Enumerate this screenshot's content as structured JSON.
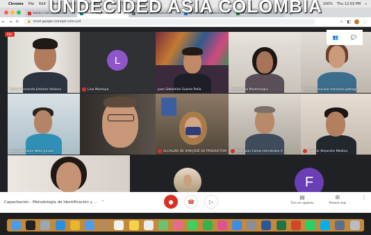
{
  "watermark": "UNDECIDED ASIA COLOMBIA",
  "menubar": {
    "app_name": "Chrome",
    "items": [
      "File",
      "Edit",
      "View",
      "History",
      "Bookmarks",
      "People",
      "Tab",
      "Window",
      "Help"
    ],
    "clock": "Thu 12:03 PM",
    "battery": "100%"
  },
  "tabs": [
    {
      "title": "SOLICITUD DE REUNIÓN - Jul",
      "color": "#d93025",
      "active": false
    },
    {
      "title": "Meet - Capacitación - Me",
      "color": "#00897b",
      "active": true
    },
    {
      "title": "Publicación | Buscar Fechas",
      "color": "#5f6368",
      "active": false
    },
    {
      "title": "aprendizaje | Busca con Gr",
      "color": "#1a73e8",
      "active": false
    },
    {
      "title": "Reuniones virtuales | Meet",
      "color": "#188038",
      "active": false
    }
  ],
  "address": {
    "url": "meet.google.com/qei-xvhs-yrd"
  },
  "meet": {
    "rec_label": "REC",
    "tiles": [
      {
        "name": "Carlos Fernando Jiménez Velasco",
        "mic_off": false
      },
      {
        "name": "Lina Montoya",
        "mic_off": true,
        "letter": "L",
        "avatar_color": "#8e56c9"
      },
      {
        "name": "Juan Sebastián Suárez Peña",
        "mic_off": false
      },
      {
        "name": "Andrea Paz Montenegro",
        "mic_off": false
      },
      {
        "name": "claudia consuelo mendoza gallego",
        "mic_off": false
      },
      {
        "name": "sonia stiphanie Nieto Jurado",
        "mic_off": false
      },
      {
        "name": "",
        "mic_off": false
      },
      {
        "name": "ALCALDÍA DE SAN JOSÉ DE PRODUCTIVA",
        "mic_off": true
      },
      {
        "name": "Jhon Juan Carlos Hernández V",
        "mic_off": true
      },
      {
        "name": "Camilo Alejandro Medina",
        "mic_off": true
      },
      {
        "name": "",
        "mic_off": false
      },
      {
        "name": "",
        "mic_off": false
      },
      {
        "name": "",
        "mic_off": false,
        "letter": "F",
        "avatar_color": "#6a3fb5"
      }
    ]
  },
  "bottombar": {
    "meeting_title": "Capacitación - Metodología de identificación y ...",
    "caret": "^",
    "captions_label": "Turn on captions",
    "present_label": "Present now"
  },
  "icons": {
    "mic": "mic-icon",
    "hangup": "hangup-icon",
    "camera": "camera-icon"
  }
}
